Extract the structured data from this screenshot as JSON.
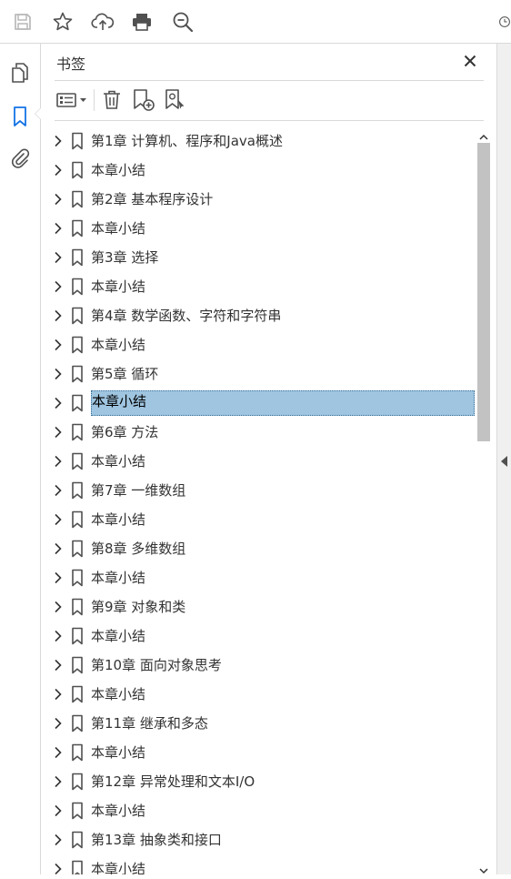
{
  "toolbar": {
    "buttons": [
      {
        "name": "save-icon",
        "enabled": false
      },
      {
        "name": "star-icon",
        "enabled": true
      },
      {
        "name": "upload-cloud-icon",
        "enabled": true
      },
      {
        "name": "print-icon",
        "enabled": true
      },
      {
        "name": "zoom-out-icon",
        "enabled": true
      }
    ]
  },
  "left_rail": {
    "items": [
      {
        "name": "pages-icon",
        "active": false
      },
      {
        "name": "bookmark-icon",
        "active": true
      },
      {
        "name": "attachment-icon",
        "active": false
      }
    ]
  },
  "bookmarks_panel": {
    "title": "书签",
    "close_icon": "close-icon",
    "tools": [
      "options-menu-icon",
      "delete-icon",
      "add-bookmark-icon",
      "find-bookmark-icon"
    ],
    "selected_index": 9,
    "items": [
      {
        "label": "第1章  计算机、程序和Java概述"
      },
      {
        "label": "本章小结"
      },
      {
        "label": "第2章  基本程序设计"
      },
      {
        "label": "本章小结"
      },
      {
        "label": "第3章  选择"
      },
      {
        "label": "本章小结"
      },
      {
        "label": "第4章  数学函数、字符和字符串"
      },
      {
        "label": "本章小结"
      },
      {
        "label": "第5章  循环"
      },
      {
        "label": "本章小结"
      },
      {
        "label": "第6章  方法"
      },
      {
        "label": "本章小结"
      },
      {
        "label": "第7章  一维数组"
      },
      {
        "label": "本章小结"
      },
      {
        "label": "第8章  多维数组"
      },
      {
        "label": "本章小结"
      },
      {
        "label": "第9章  对象和类"
      },
      {
        "label": "本章小结"
      },
      {
        "label": "第10章  面向对象思考"
      },
      {
        "label": "本章小结"
      },
      {
        "label": "第11章  继承和多态"
      },
      {
        "label": "本章小结"
      },
      {
        "label": "第12章  异常处理和文本I/O"
      },
      {
        "label": "本章小结"
      },
      {
        "label": "第13章  抽象类和接口"
      },
      {
        "label": "本章小结"
      }
    ]
  },
  "colors": {
    "accent": "#1473e6",
    "selection": "#9fc5e0",
    "icon": "#505050",
    "disabled": "#b4b4b4"
  }
}
